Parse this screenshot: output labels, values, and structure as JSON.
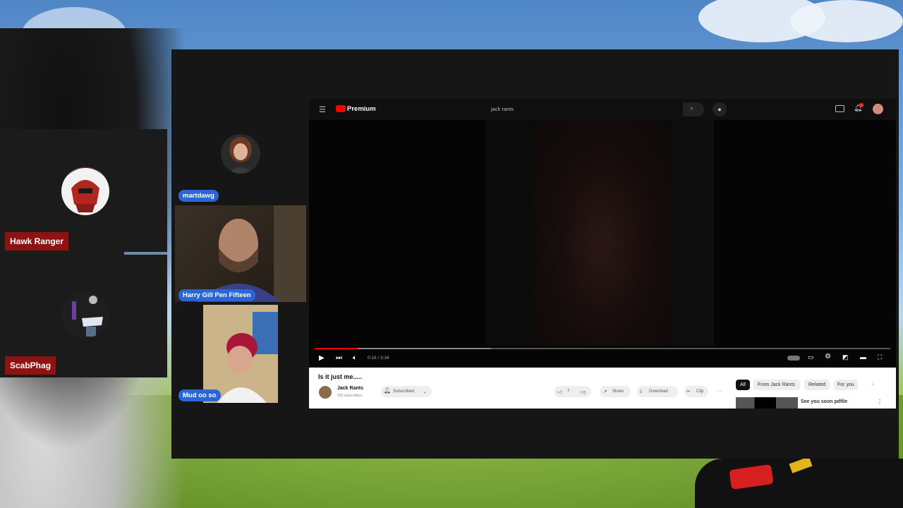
{
  "participants_left": [
    {
      "name": "Hawk Ranger"
    },
    {
      "name": "ScabPhag"
    }
  ],
  "guests": [
    {
      "name": "martdawg"
    },
    {
      "name": "Harry Gill Pen Fifteen"
    },
    {
      "name": "Mud oo so"
    }
  ],
  "youtube": {
    "logo_text": "Premium",
    "search_query": "jack rants",
    "time_display": "0:16 / 3:34",
    "video_title": "Is it just me.....",
    "channel_name": "Jack Rants",
    "subscribers": "363 subscribers",
    "subscribe_label": "Subscribed",
    "likes": "7",
    "share_label": "Share",
    "download_label": "Download",
    "clip_label": "Clip",
    "more_label": "···",
    "progress_fraction": 0.075,
    "filter_chips": [
      "All",
      "From Jack Rants",
      "Related",
      "For you"
    ],
    "recommended_title": "See you soon pdfile"
  },
  "colors": {
    "name_tag_bg": "#8e1212",
    "guest_pill_bg": "#2a66d8",
    "yt_red": "#ff0000"
  }
}
